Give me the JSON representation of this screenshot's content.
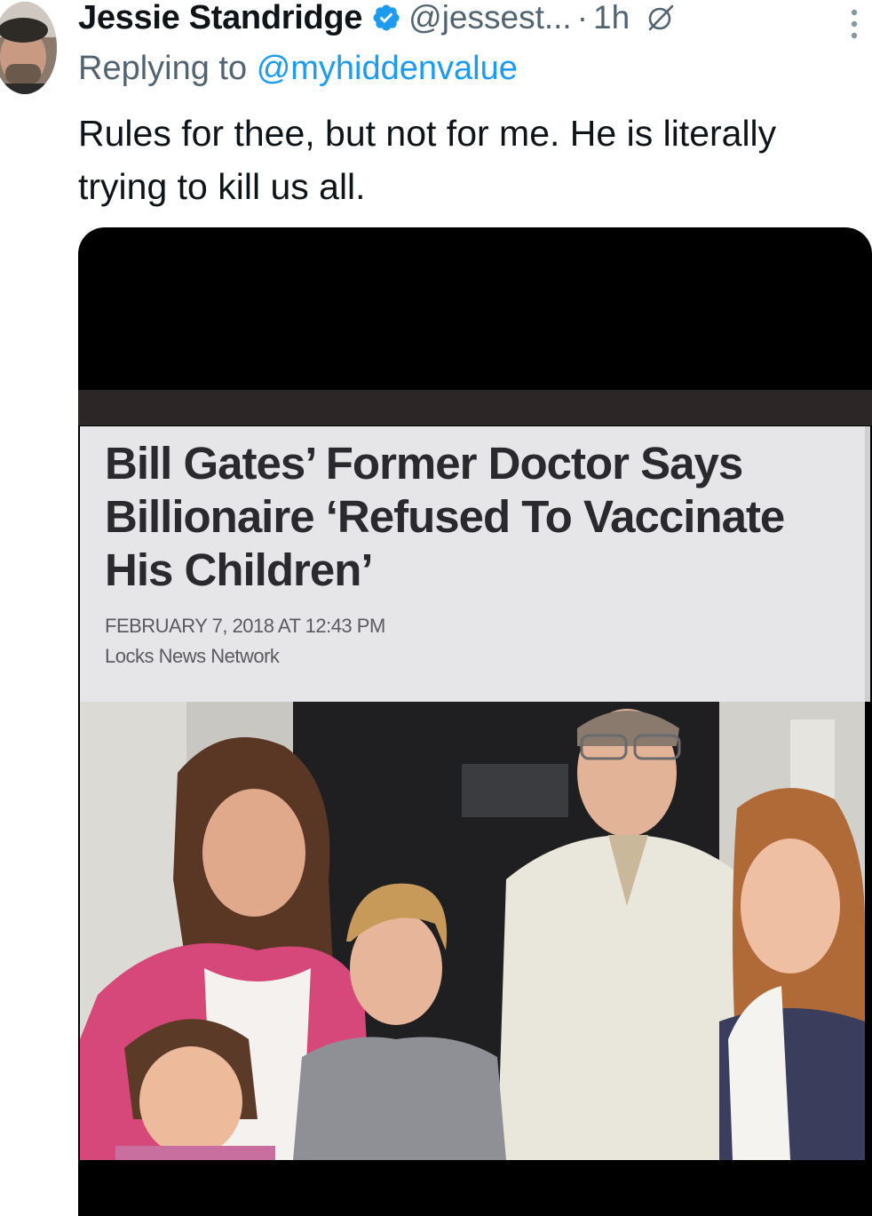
{
  "tweet": {
    "author_name": "Jessie Standridge",
    "handle": "@jessest...",
    "separator": "·",
    "time": "1h",
    "replying_prefix": "Replying to",
    "replying_to": "@myhiddenvalue",
    "text": "Rules for thee, but not for me.  He is literally trying to kill us all."
  },
  "icons": {
    "verified": "verified-badge-icon",
    "grok": "grok-icon",
    "more": "more-options-icon"
  },
  "media": {
    "headline": "Bill Gates’ Former Doctor Says Billionaire ‘Refused To Vaccinate His Children’",
    "date": "FEBRUARY 7, 2018 AT 12:43 PM",
    "source": "Locks News Network"
  },
  "colors": {
    "text": "#0f1419",
    "secondary": "#536471",
    "link": "#1d9bf0",
    "verified": "#1d9bf0"
  }
}
